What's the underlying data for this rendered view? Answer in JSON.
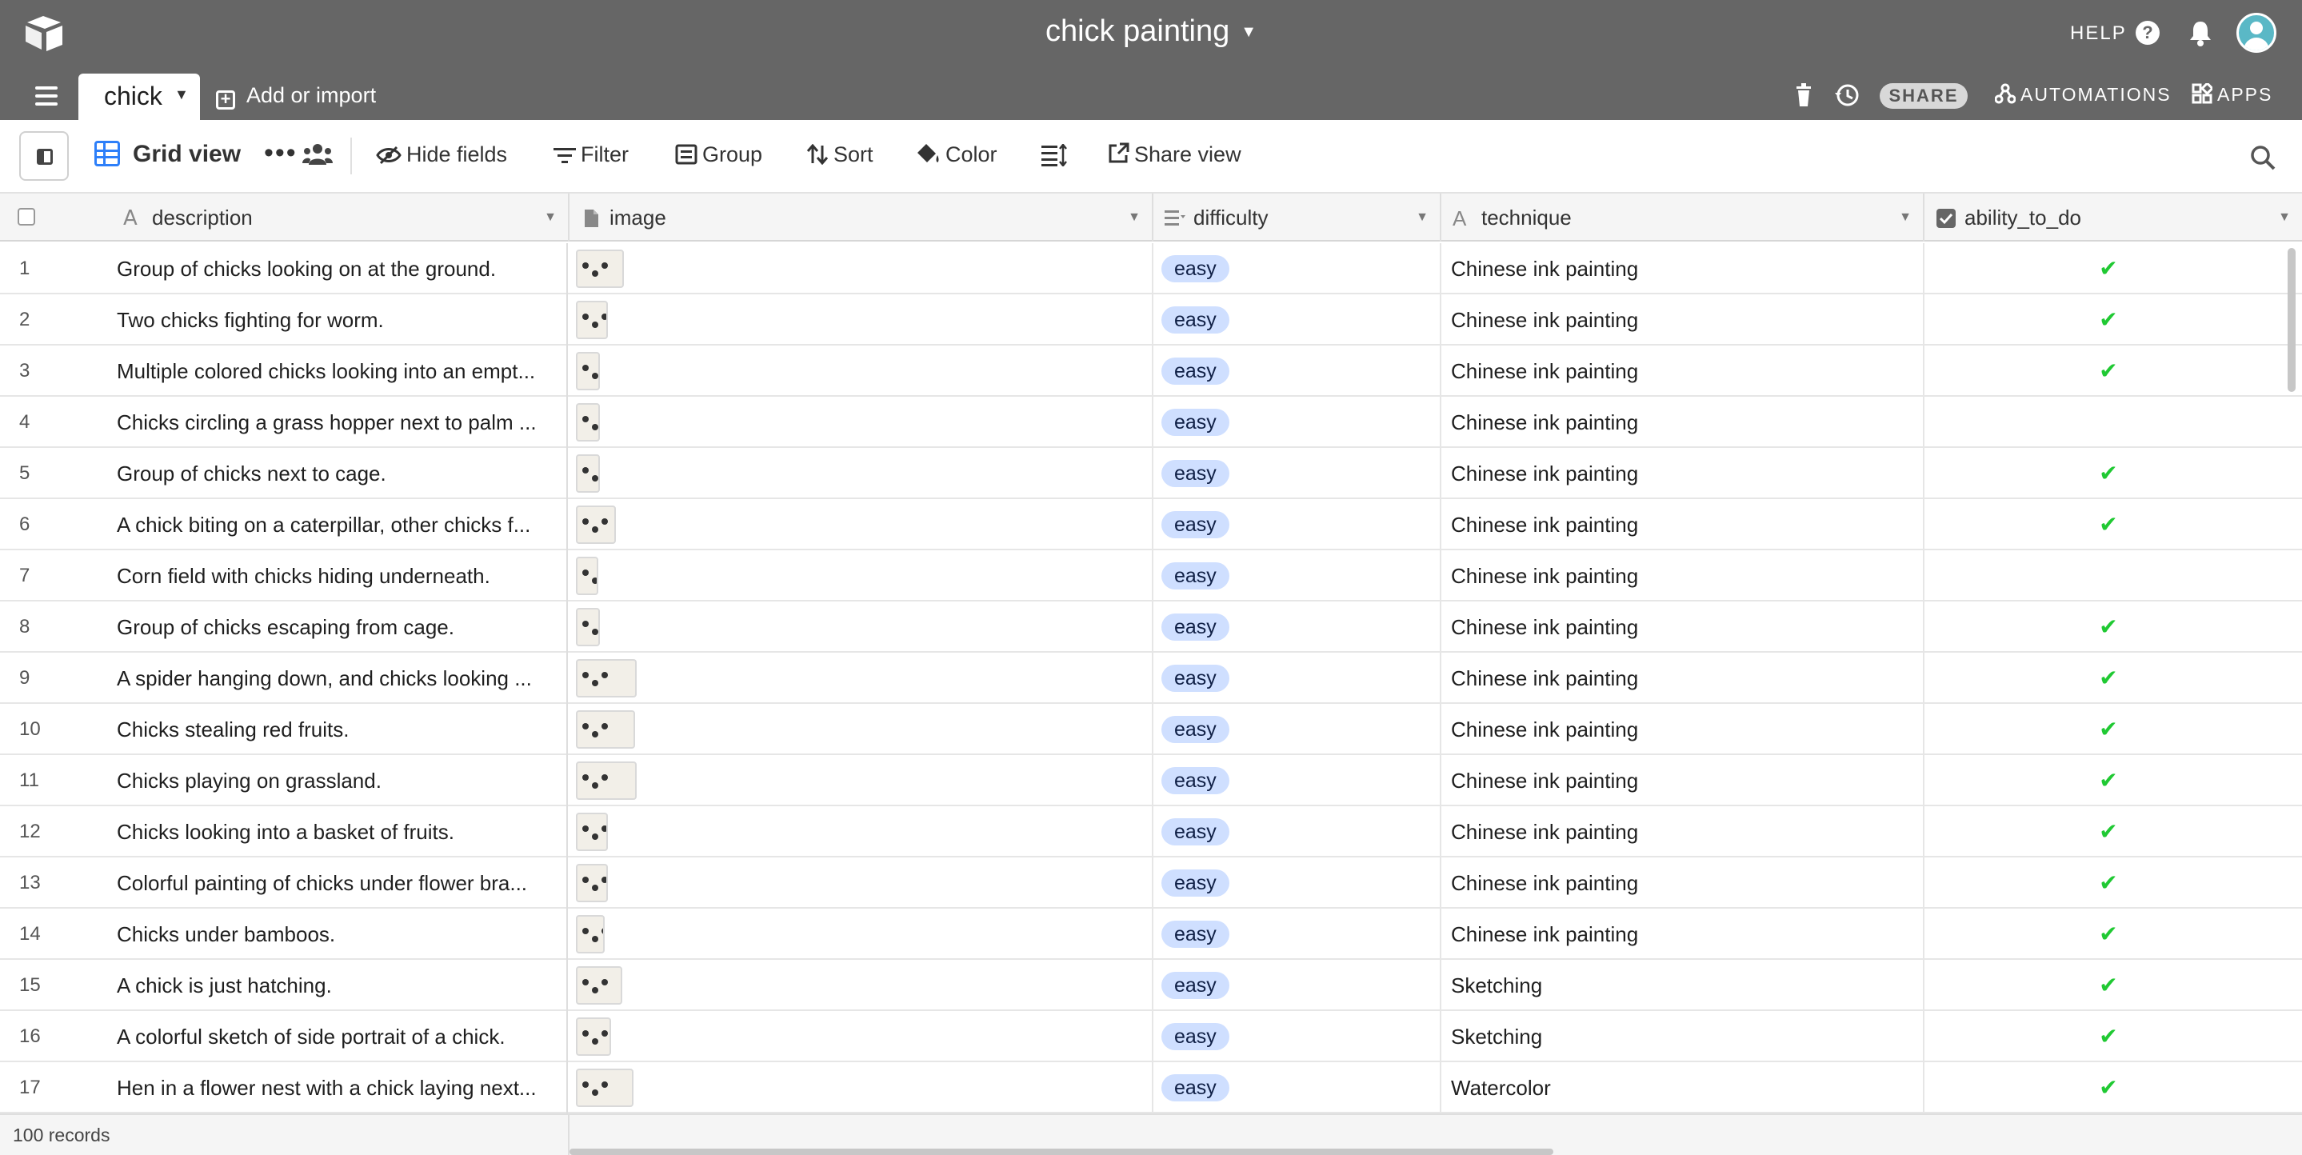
{
  "header": {
    "base_title": "chick painting",
    "help_label": "HELP",
    "table_tab": "chick",
    "add_import_label": "Add or import",
    "share_label": "SHARE",
    "automations_label": "AUTOMATIONS",
    "apps_label": "APPS"
  },
  "viewbar": {
    "view_name": "Grid view",
    "hide_fields": "Hide fields",
    "filter": "Filter",
    "group": "Group",
    "sort": "Sort",
    "color": "Color",
    "share_view": "Share view"
  },
  "columns": [
    {
      "name": "description",
      "type_icon": "text-icon"
    },
    {
      "name": "image",
      "type_icon": "attachment-icon"
    },
    {
      "name": "difficulty",
      "type_icon": "single-select-icon"
    },
    {
      "name": "technique",
      "type_icon": "text-icon"
    },
    {
      "name": "ability_to_do",
      "type_icon": "checkbox-icon"
    }
  ],
  "rows": [
    {
      "num": "1",
      "description": "Group of chicks looking on at the ground.",
      "difficulty": "easy",
      "technique": "Chinese ink painting",
      "ability": "✔"
    },
    {
      "num": "2",
      "description": "Two chicks fighting for worm.",
      "difficulty": "easy",
      "technique": "Chinese ink painting",
      "ability": "✔"
    },
    {
      "num": "3",
      "description": "Multiple colored chicks looking into an empt...",
      "difficulty": "easy",
      "technique": "Chinese ink painting",
      "ability": "✔"
    },
    {
      "num": "4",
      "description": "Chicks circling a grass hopper next to palm ...",
      "difficulty": "easy",
      "technique": "Chinese ink painting",
      "ability": ""
    },
    {
      "num": "5",
      "description": "Group of chicks next to cage.",
      "difficulty": "easy",
      "technique": "Chinese ink painting",
      "ability": "✔"
    },
    {
      "num": "6",
      "description": "A chick biting on a caterpillar, other chicks f...",
      "difficulty": "easy",
      "technique": "Chinese ink painting",
      "ability": "✔"
    },
    {
      "num": "7",
      "description": "Corn field with chicks hiding underneath.",
      "difficulty": "easy",
      "technique": "Chinese ink painting",
      "ability": ""
    },
    {
      "num": "8",
      "description": "Group of chicks escaping from cage.",
      "difficulty": "easy",
      "technique": "Chinese ink painting",
      "ability": "✔"
    },
    {
      "num": "9",
      "description": "A spider hanging down, and chicks looking ...",
      "difficulty": "easy",
      "technique": "Chinese ink painting",
      "ability": "✔"
    },
    {
      "num": "10",
      "description": "Chicks stealing red fruits.",
      "difficulty": "easy",
      "technique": "Chinese ink painting",
      "ability": "✔"
    },
    {
      "num": "11",
      "description": "Chicks playing on grassland.",
      "difficulty": "easy",
      "technique": "Chinese ink painting",
      "ability": "✔"
    },
    {
      "num": "12",
      "description": "Chicks looking into a basket of fruits.",
      "difficulty": "easy",
      "technique": "Chinese ink painting",
      "ability": "✔"
    },
    {
      "num": "13",
      "description": "Colorful painting of chicks under flower bra...",
      "difficulty": "easy",
      "technique": "Chinese ink painting",
      "ability": "✔"
    },
    {
      "num": "14",
      "description": "Chicks under bamboos.",
      "difficulty": "easy",
      "technique": "Chinese ink painting",
      "ability": "✔"
    },
    {
      "num": "15",
      "description": "A chick is just hatching.",
      "difficulty": "easy",
      "technique": "Sketching",
      "ability": "✔"
    },
    {
      "num": "16",
      "description": "A colorful sketch of side portrait of a chick.",
      "difficulty": "easy",
      "technique": "Sketching",
      "ability": "✔"
    },
    {
      "num": "17",
      "description": "Hen in a flower nest with a chick laying next...",
      "difficulty": "easy",
      "technique": "Watercolor",
      "ability": "✔"
    }
  ],
  "footer": {
    "record_count": "100 records"
  },
  "colors": {
    "header_bg": "#666666",
    "accent_blue": "#2d7ff9",
    "pill_bg": "#cfdfff",
    "check_green": "#20c933"
  }
}
